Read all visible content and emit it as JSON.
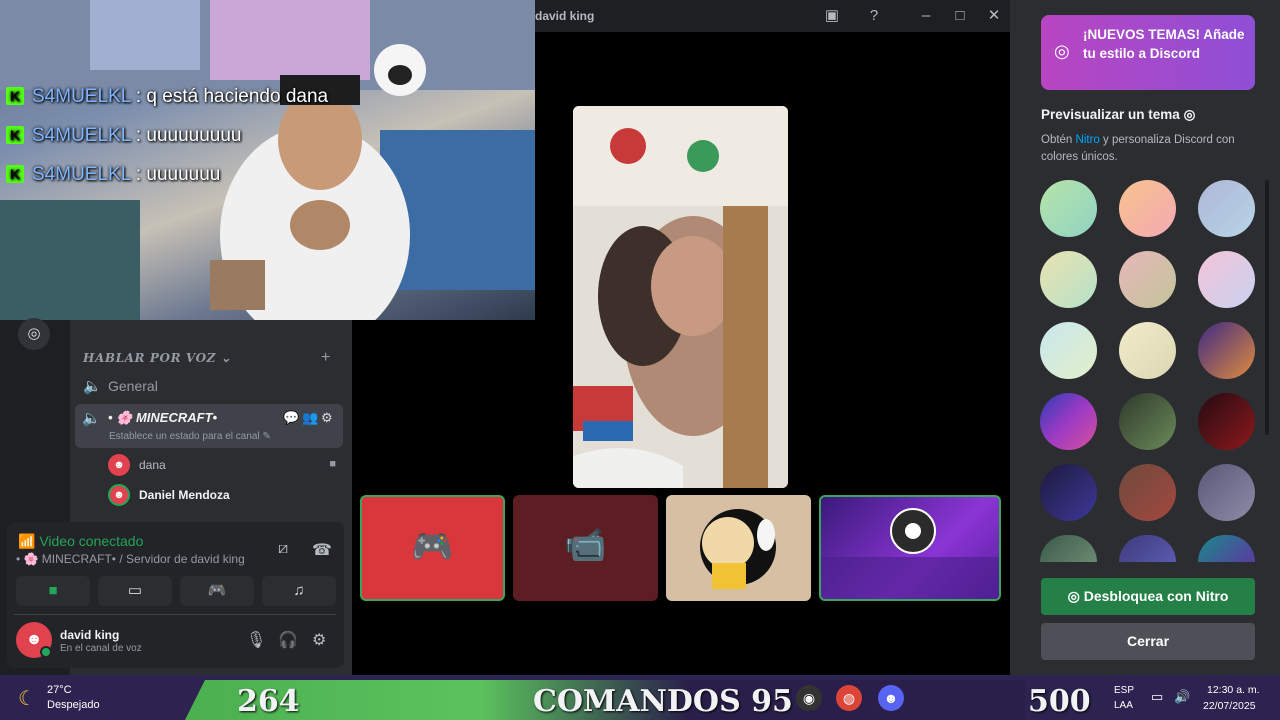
{
  "window": {
    "title": "david king"
  },
  "stream_chat": [
    {
      "user": "S4MUELKL",
      "message": ": q está haciendo dana"
    },
    {
      "user": "S4MUELKL",
      "message": ": uuuuuuuuu"
    },
    {
      "user": "S4MUELKL",
      "message": ": uuuuuuu"
    }
  ],
  "sidebar": {
    "voice_category": "HABLAR POR VOZ",
    "add_symbol": "+",
    "channels": [
      {
        "name": "General"
      },
      {
        "name": "• 🌸 MINECRAFT•",
        "status_placeholder": "Establece un estado para el canal"
      }
    ],
    "voice_users": [
      {
        "name": "dana"
      },
      {
        "name": "Daniel Mendoza"
      }
    ]
  },
  "voice_panel": {
    "status": "Video conectado",
    "channel": "• 🌸 MINECRAFT• / Servidor de david king"
  },
  "user": {
    "name": "david king",
    "status": "En el canal de voz"
  },
  "theme_panel": {
    "promo": "¡NUEVOS TEMAS! Añade tu estilo a Discord",
    "preview_title": "Previsualizar un tema",
    "description_before": "Obtén ",
    "description_link": "Nitro",
    "description_after": " y personaliza Discord con colores únicos.",
    "unlock_button": "Desbloquea con Nitro",
    "close_button": "Cerrar",
    "swatches": [
      "linear-gradient(135deg,#b7e4a9,#8fd3c2)",
      "linear-gradient(135deg,#f7c38c,#f3a9b4)",
      "linear-gradient(135deg,#aeb6d8,#b7d5e6)",
      "linear-gradient(135deg,#eae2b1,#b5e2c8)",
      "linear-gradient(135deg,#e6b7b9,#c2c59a)",
      "linear-gradient(135deg,#f4c3d7,#c8d2f0)",
      "linear-gradient(135deg,#c8e6ee,#e2f0c8)",
      "linear-gradient(135deg,#f1ebcb,#dcd7b2)",
      "linear-gradient(135deg,#3e2a86,#e08b3d)",
      "linear-gradient(135deg,#2c3db5,#9d3ac4,#d6519b)",
      "linear-gradient(135deg,#2f3a2c,#6b8a59)",
      "linear-gradient(135deg,#240a10,#8d1a1e)",
      "linear-gradient(135deg,#1c1a3d,#3f3898)",
      "linear-gradient(135deg,#6e4a3d,#a3483e)",
      "linear-gradient(135deg,#5a5878,#8e8ca8)",
      "linear-gradient(135deg,#3a5a4a,#6b8a72)",
      "linear-gradient(135deg,#3d3a7a,#5a5ab0)",
      "linear-gradient(135deg,#1a8a8a,#5a3aa0)"
    ]
  },
  "taskbar": {
    "weather_temp": "27°C",
    "weather_desc": "Despejado",
    "score_left": "264",
    "banner": "COMANDOS 95",
    "score_right": "500",
    "lang_top": "ESP",
    "lang_bottom": "LAA",
    "time": "12:30 a. m.",
    "date": "22/07/2025"
  }
}
